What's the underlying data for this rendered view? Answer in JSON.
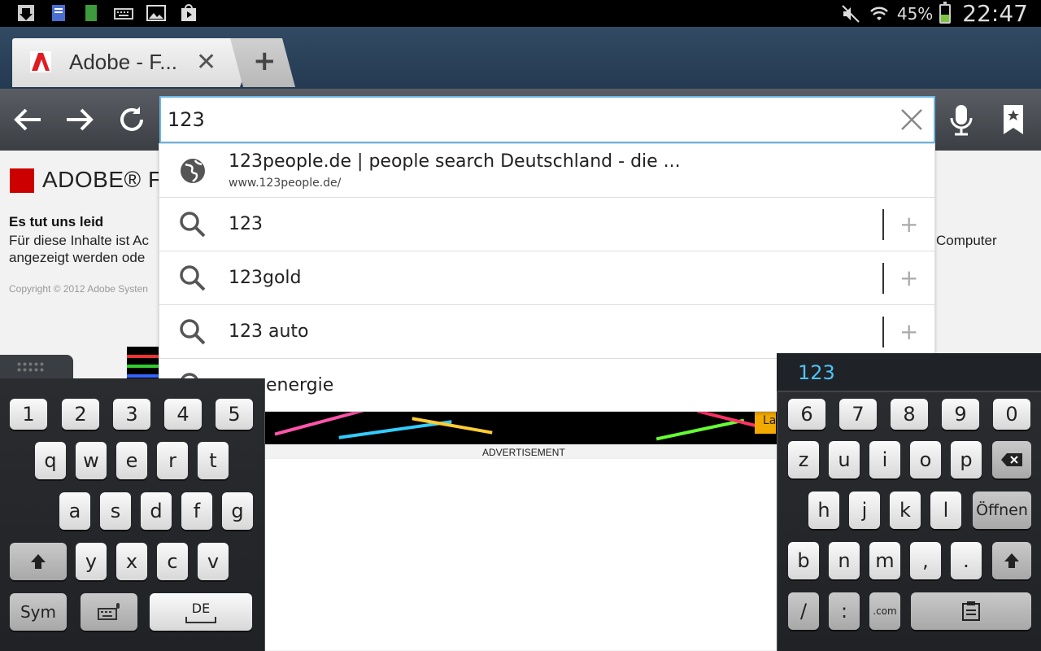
{
  "status_bar": {
    "battery_percent": "45%",
    "clock": "22:47",
    "left_icons": [
      "download-icon",
      "notes-icon",
      "book-icon",
      "keyboard-icon",
      "gallery-icon",
      "play-store-icon"
    ],
    "right_icons": [
      "mute-icon",
      "wifi-icon",
      "battery-icon"
    ],
    "battery_level": 0.45
  },
  "tabs": {
    "active_title": "Adobe - F...",
    "close_glyph": "✕",
    "new_tab_glyph": "+"
  },
  "toolbar": {
    "url_value": "123"
  },
  "page": {
    "flash_brand": "ADOBE® FLA",
    "sorry_heading": "Es tut uns leid",
    "sorry_line1": "Für diese Inhalte ist Ac",
    "sorry_line2": "angezeigt werden ode",
    "sorry_right": "Computer",
    "copyright": "Copyright © 2012 Adobe Systen",
    "ad_caption": "ADVERTISEMENT",
    "ad_tag": "La"
  },
  "suggestions": [
    {
      "type": "history",
      "title": "123people.de | people search Deutschland - die ...",
      "url": "www.123people.de/"
    },
    {
      "type": "search",
      "text": "123"
    },
    {
      "type": "search",
      "text": "123gold"
    },
    {
      "type": "search",
      "text": "123 auto"
    },
    {
      "type": "search",
      "text": "energie"
    }
  ],
  "keyboard": {
    "candidate": "123",
    "left_rows": {
      "numbers": [
        "1",
        "2",
        "3",
        "4",
        "5"
      ],
      "row1": [
        "q",
        "w",
        "e",
        "r",
        "t"
      ],
      "row2": [
        "a",
        "s",
        "d",
        "f",
        "g"
      ],
      "row3": [
        "y",
        "x",
        "c",
        "v"
      ],
      "sym": "Sym",
      "lang": "DE"
    },
    "right_rows": {
      "numbers": [
        "6",
        "7",
        "8",
        "9",
        "0"
      ],
      "row1": [
        "z",
        "u",
        "i",
        "o",
        "p"
      ],
      "row2": [
        "h",
        "j",
        "k",
        "l"
      ],
      "open": "Öffnen",
      "row3": [
        "b",
        "n",
        "m",
        ",",
        "."
      ],
      "slash": "/",
      "colon": ":",
      "dotcom": ".com"
    }
  }
}
